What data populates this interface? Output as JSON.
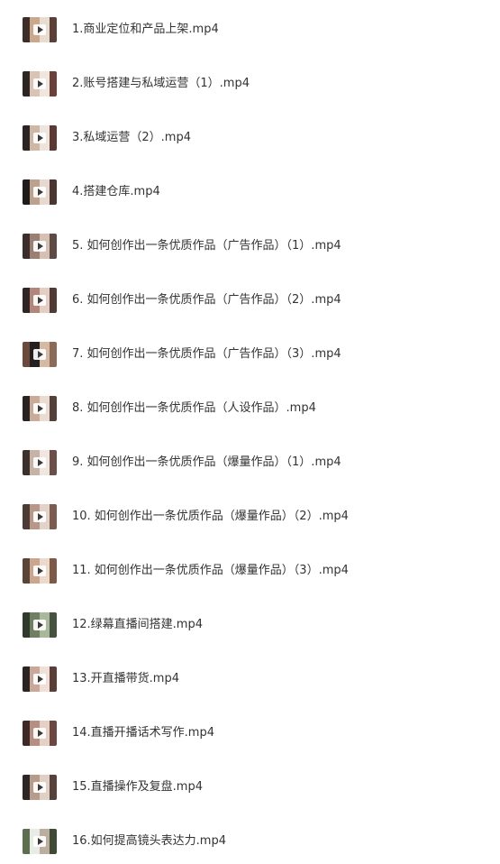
{
  "files": [
    {
      "name": "1.商业定位和产品上架.mp4",
      "thumb_colors": [
        "#3c2e26",
        "#c9a88c",
        "#e8dcd0",
        "#5a4036"
      ]
    },
    {
      "name": "2.账号搭建与私域运营（1）.mp4",
      "thumb_colors": [
        "#2d2522",
        "#d8c3b4",
        "#f1e6de",
        "#6b3f3a"
      ]
    },
    {
      "name": "3.私域运营（2）.mp4",
      "thumb_colors": [
        "#2b2422",
        "#cfb7a6",
        "#efe4dc",
        "#5c3a34"
      ]
    },
    {
      "name": "4.搭建仓库.mp4",
      "thumb_colors": [
        "#1f1b1a",
        "#bda18f",
        "#e6d9cf",
        "#4a3631"
      ]
    },
    {
      "name": "5. 如何创作出一条优质作品（广告作品）（1）.mp4",
      "thumb_colors": [
        "#3a2d2a",
        "#9a7f72",
        "#d6c0b3",
        "#5d4a44"
      ]
    },
    {
      "name": "6. 如何创作出一条优质作品（广告作品）（2）.mp4",
      "thumb_colors": [
        "#2f2524",
        "#b2867a",
        "#e4cec4",
        "#4f3a36"
      ]
    },
    {
      "name": "7. 如何创作出一条优质作品（广告作品）（3）.mp4",
      "thumb_colors": [
        "#6b4a3b",
        "#24201f",
        "#d5b9a3",
        "#8a6b57"
      ]
    },
    {
      "name": "8. 如何创作出一条优质作品（人设作品）.mp4",
      "thumb_colors": [
        "#2a2220",
        "#c9ab98",
        "#ebdcd2",
        "#53403a"
      ]
    },
    {
      "name": "9. 如何创作出一条优质作品（爆量作品）（1）.mp4",
      "thumb_colors": [
        "#3b302c",
        "#c7b2a6",
        "#efe6e0",
        "#6a5048"
      ]
    },
    {
      "name": "10. 如何创作出一条优质作品（爆量作品）（2）.mp4",
      "thumb_colors": [
        "#4b3b34",
        "#b79888",
        "#e3d2c7",
        "#7a5d50"
      ]
    },
    {
      "name": "11. 如何创作出一条优质作品（爆量作品）（3）.mp4",
      "thumb_colors": [
        "#5a4337",
        "#caa68e",
        "#ecd9cb",
        "#7d5a48"
      ]
    },
    {
      "name": "12.绿幕直播间搭建.mp4",
      "thumb_colors": [
        "#2f3a2c",
        "#6f7f62",
        "#a8b89a",
        "#46523f"
      ]
    },
    {
      "name": "13.开直播带货.mp4",
      "thumb_colors": [
        "#2b2422",
        "#c9a899",
        "#efdfd6",
        "#5a3e38"
      ]
    },
    {
      "name": "14.直播开播话术写作.mp4",
      "thumb_colors": [
        "#3d2a27",
        "#b58f82",
        "#e6d0c6",
        "#6a4741"
      ]
    },
    {
      "name": "15.直播操作及复盘.mp4",
      "thumb_colors": [
        "#2e2624",
        "#b79b8b",
        "#e0cfc4",
        "#57423b"
      ]
    },
    {
      "name": "16.如何提高镜头表达力.mp4",
      "thumb_colors": [
        "#5d6e4e",
        "#e9ebe6",
        "#bcae9f",
        "#3f4a36"
      ]
    }
  ]
}
